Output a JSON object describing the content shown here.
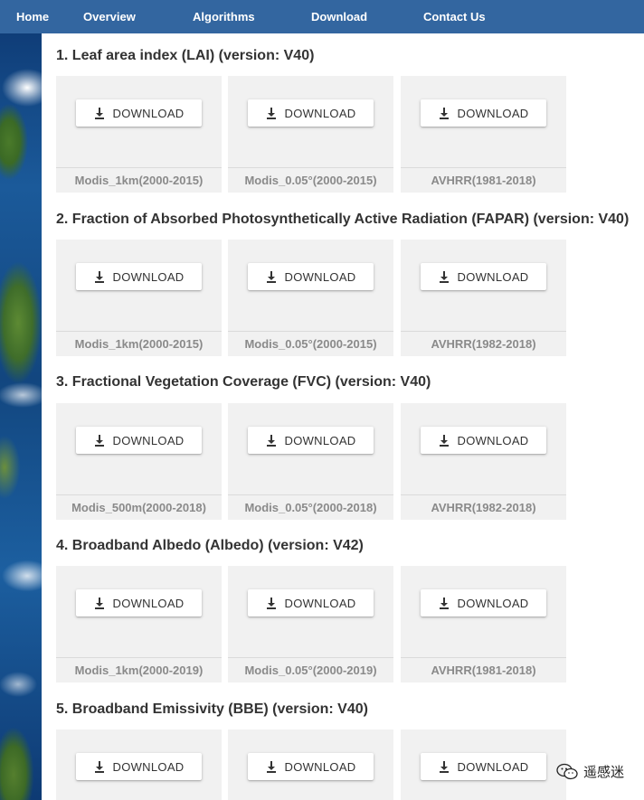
{
  "nav": {
    "items": [
      "Home",
      "Overview",
      "Algorithms",
      "Download",
      "Contact Us"
    ]
  },
  "button_label": "DOWNLOAD",
  "sections": [
    {
      "title": "1. Leaf area index (LAI) (version: V40)",
      "cards": [
        "Modis_1km(2000-2015)",
        "Modis_0.05°(2000-2015)",
        "AVHRR(1981-2018)"
      ]
    },
    {
      "title": "2. Fraction of Absorbed Photosynthetically Active Radiation (FAPAR) (version: V40)",
      "cards": [
        "Modis_1km(2000-2015)",
        "Modis_0.05°(2000-2015)",
        "AVHRR(1982-2018)"
      ]
    },
    {
      "title": "3. Fractional Vegetation Coverage (FVC) (version: V40)",
      "cards": [
        "Modis_500m(2000-2018)",
        "Modis_0.05°(2000-2018)",
        "AVHRR(1982-2018)"
      ]
    },
    {
      "title": "4. Broadband Albedo (Albedo) (version: V42)",
      "cards": [
        "Modis_1km(2000-2019)",
        "Modis_0.05°(2000-2019)",
        "AVHRR(1981-2018)"
      ]
    },
    {
      "title": "5. Broadband Emissivity (BBE) (version: V40)",
      "cards": [
        "",
        "",
        ""
      ]
    }
  ],
  "watermark": {
    "text": "遥感迷",
    "icon": "wechat-icon"
  },
  "colors": {
    "navbar": "#3366a0",
    "card_bg": "#f1f1f1",
    "title_text": "#333333",
    "footer_text": "#8a8a8a"
  }
}
